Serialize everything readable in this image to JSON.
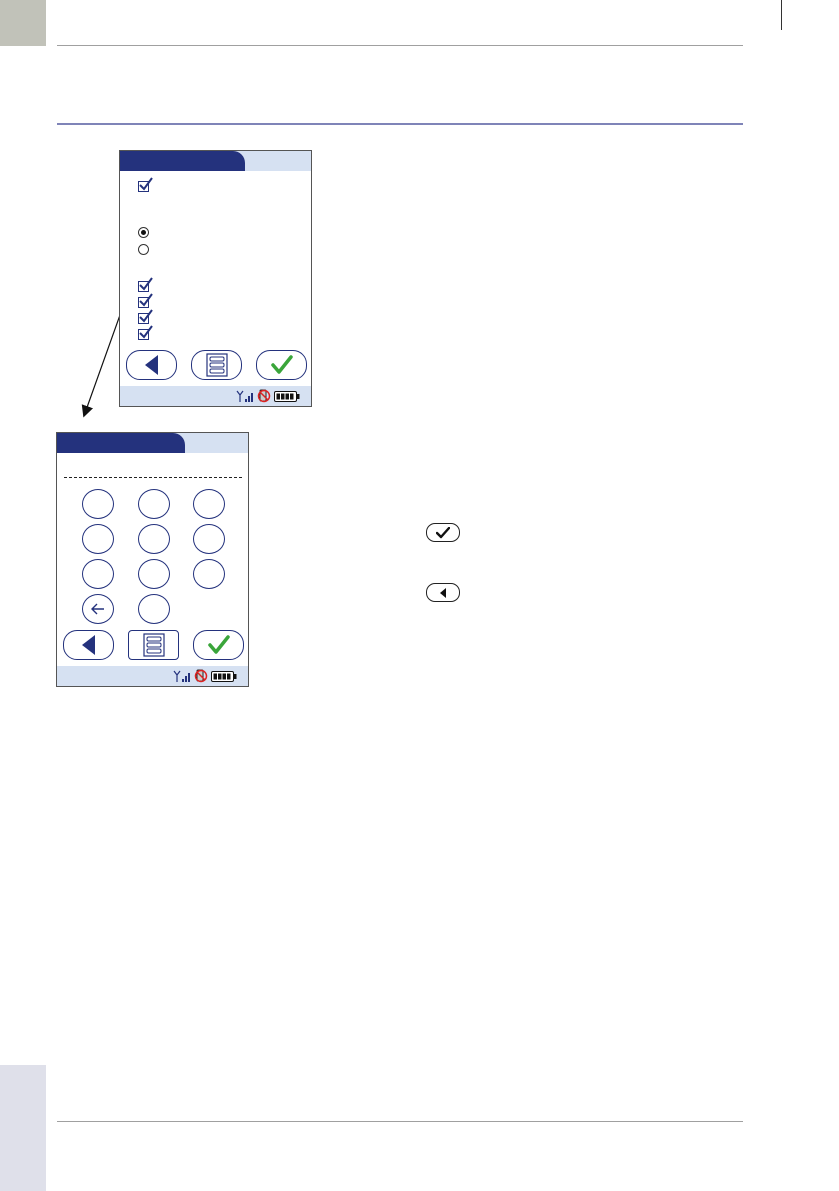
{
  "page": {
    "colors": {
      "brand_navy": "#24327d",
      "screen_bar": "#d6e1f2",
      "confirm_green": "#3aa53a",
      "top_tab": "#c1c2b9",
      "bottom_tab": "#dfe0ea",
      "section_rule": "#7f84b8"
    }
  },
  "screen_1": {
    "icons": {
      "checkboxes": [
        "checkbox-checked",
        "checkbox-checked",
        "checkbox-checked",
        "checkbox-checked",
        "checkbox-checked"
      ],
      "radios": [
        "radio-selected",
        "radio-empty"
      ],
      "buttons": [
        "back-triangle-icon",
        "menu-list-icon",
        "confirm-check-icon"
      ],
      "status": [
        "wireless-signal-icon",
        "no-docking-icon",
        "battery-full-icon"
      ]
    }
  },
  "screen_2": {
    "icons": {
      "keys": 11,
      "backspace": "arrow-left-icon",
      "buttons": [
        "back-triangle-icon",
        "menu-list-icon",
        "confirm-check-icon"
      ],
      "status": [
        "wireless-signal-icon",
        "no-docking-icon",
        "battery-full-icon"
      ]
    }
  },
  "body_icons": [
    "confirm-check-icon",
    "back-triangle-icon"
  ]
}
